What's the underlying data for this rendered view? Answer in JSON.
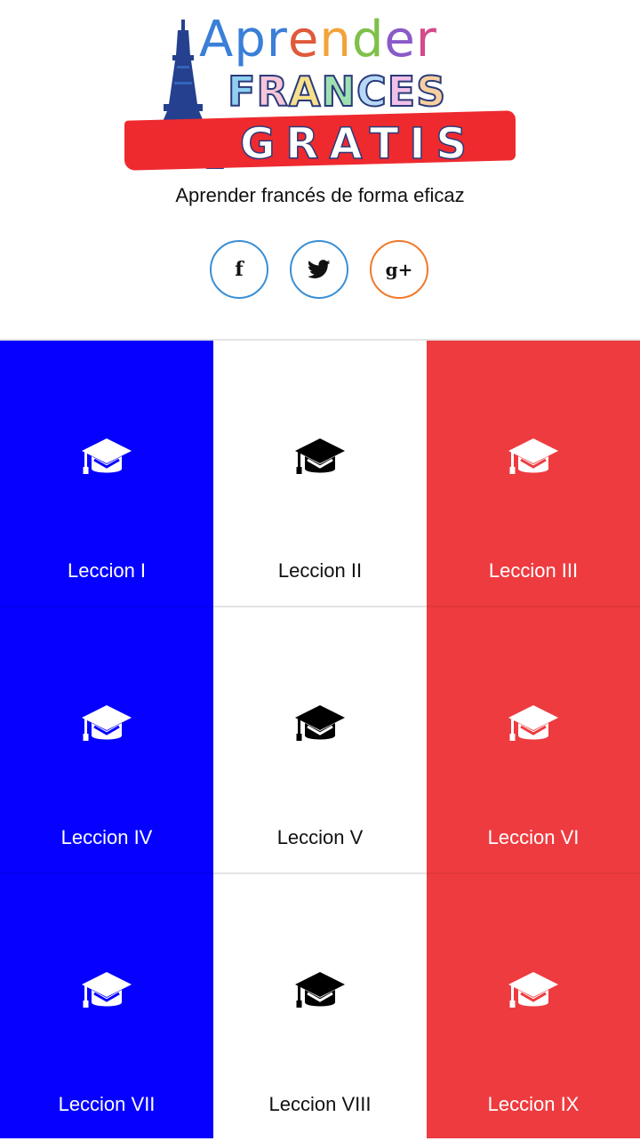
{
  "logo": {
    "line1": [
      "A",
      "p",
      "r",
      "e",
      "n",
      "d",
      "e",
      "r"
    ],
    "line1_colors": [
      "#3a7fd8",
      "#3a7fd8",
      "#3a7fd8",
      "#e05a3a",
      "#f2a33a",
      "#7fc04a",
      "#8a5ac8",
      "#d44a8a"
    ],
    "line2": [
      "F",
      "R",
      "A",
      "N",
      "C",
      "E",
      "S"
    ],
    "line2_colors": [
      "#8fd0f0",
      "#f6c6d8",
      "#f7e08a",
      "#9fe0b0",
      "#b8d8f8",
      "#f0c0e8",
      "#f7d0a0"
    ],
    "line3": "GRATIS",
    "banner_color": "#ee2a2f"
  },
  "tagline": "Aprender francés de forma eficaz",
  "social": [
    {
      "name": "facebook",
      "label": "f",
      "icon": "facebook-icon",
      "color": "#3b8fd4"
    },
    {
      "name": "twitter",
      "label": "",
      "icon": "twitter-icon",
      "color": "#3b8fd4"
    },
    {
      "name": "google-plus",
      "label": "g+",
      "icon": "google-plus-icon",
      "color": "#f07a2a"
    }
  ],
  "colors": {
    "blue": "#0500ff",
    "white": "#ffffff",
    "red": "#ee3b3f"
  },
  "lessons": [
    {
      "label": "Leccion I",
      "icon": "graduation-cap-icon"
    },
    {
      "label": "Leccion II",
      "icon": "graduation-cap-icon"
    },
    {
      "label": "Leccion III",
      "icon": "graduation-cap-icon"
    },
    {
      "label": "Leccion IV",
      "icon": "graduation-cap-icon"
    },
    {
      "label": "Leccion V",
      "icon": "graduation-cap-icon"
    },
    {
      "label": "Leccion VI",
      "icon": "graduation-cap-icon"
    },
    {
      "label": "Leccion VII",
      "icon": "graduation-cap-icon"
    },
    {
      "label": "Leccion VIII",
      "icon": "graduation-cap-icon"
    },
    {
      "label": "Leccion IX",
      "icon": "graduation-cap-icon"
    }
  ]
}
